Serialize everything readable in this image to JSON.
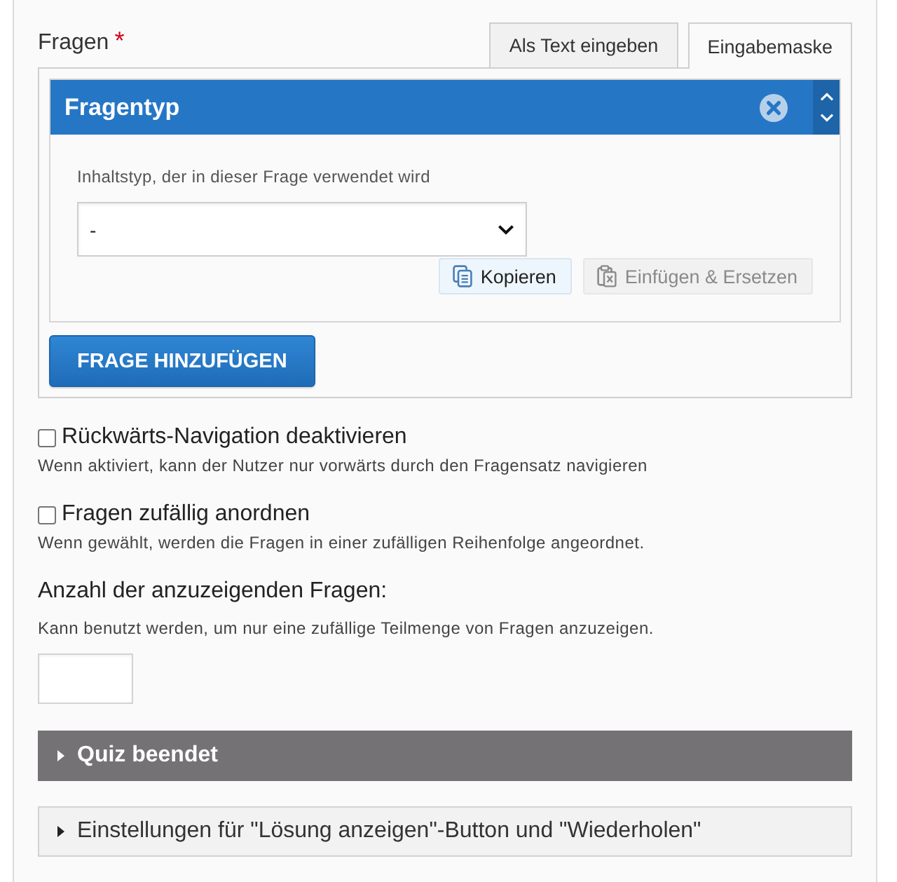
{
  "questions": {
    "label": "Fragen",
    "required_mark": "*",
    "tabs": [
      {
        "label": "Als Text eingeben",
        "selected": false
      },
      {
        "label": "Eingabemaske",
        "selected": true
      }
    ],
    "group": {
      "title": "Fragentyp",
      "content_type_label": "Inhaltstyp, der in dieser Frage verwendet wird",
      "select": {
        "value": "-"
      },
      "buttons": [
        {
          "kind": "copy",
          "label": "Kopieren",
          "disabled": false
        },
        {
          "kind": "paste",
          "label": "Einfügen & Ersetzen",
          "disabled": true
        }
      ]
    },
    "add_button": "FRAGE HINZUFÜGEN"
  },
  "options": [
    {
      "kind": "checkbox",
      "label": "Rückwärts-Navigation deaktivieren",
      "checked": false,
      "description": "Wenn aktiviert, kann der Nutzer nur vorwärts durch den Fragensatz navigieren"
    },
    {
      "kind": "checkbox",
      "label": "Fragen zufällig anordnen",
      "checked": false,
      "description": "Wenn gewählt, werden die Fragen in einer zufälligen Reihenfolge angeordnet."
    },
    {
      "kind": "number",
      "label": "Anzahl der anzuzeigenden Fragen:",
      "description": "Kann benutzt werden, um nur eine zufällige Teilmenge von Fragen anzuzeigen."
    }
  ],
  "sections": [
    {
      "kind": "highlighted",
      "title": "Quiz beendet",
      "expanded": false
    },
    {
      "kind": "plain",
      "title": "Einstellungen für \"Lösung anzeigen\"-Button und \"Wiederholen\"",
      "expanded": false
    }
  ]
}
